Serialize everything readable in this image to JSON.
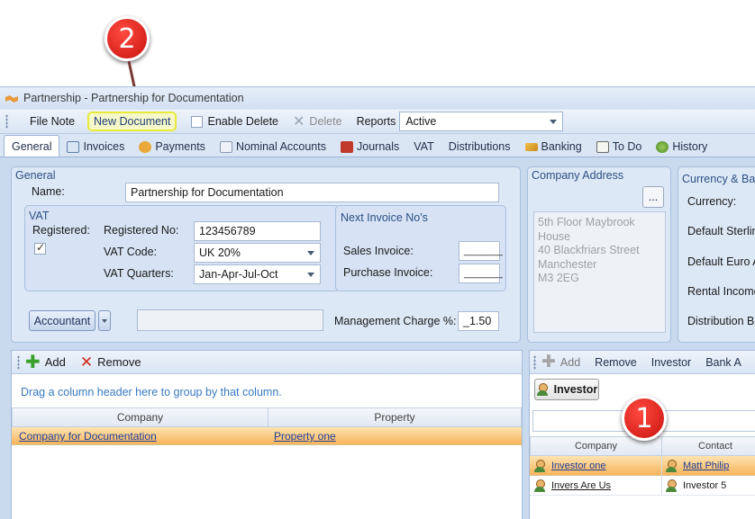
{
  "window": {
    "title": "Partnership - Partnership for Documentation"
  },
  "toolbar": {
    "file_note": "File Note",
    "new_document": "New Document",
    "enable_delete": "Enable Delete",
    "delete": "Delete",
    "reports_label": "Reports",
    "reports_value": "Active"
  },
  "tabs": [
    {
      "label": "General"
    },
    {
      "label": "Invoices"
    },
    {
      "label": "Payments"
    },
    {
      "label": "Nominal Accounts"
    },
    {
      "label": "Journals"
    },
    {
      "label": "VAT"
    },
    {
      "label": "Distributions"
    },
    {
      "label": "Banking"
    },
    {
      "label": "To Do"
    },
    {
      "label": "History"
    }
  ],
  "general": {
    "section_title": "General",
    "name_label": "Name:",
    "name_value": "Partnership for Documentation",
    "vat": {
      "title": "VAT",
      "registered_label": "Registered:",
      "registered_no_label": "Registered No:",
      "registered_no_value": "123456789",
      "vat_code_label": "VAT Code:",
      "vat_code_value": "UK 20%",
      "vat_quarters_label": "VAT Quarters:",
      "vat_quarters_value": "Jan-Apr-Jul-Oct"
    },
    "next_invoice": {
      "title": "Next Invoice No's",
      "sales_label": "Sales Invoice:",
      "sales_value": "_______",
      "purchase_label": "Purchase Invoice:",
      "purchase_value": "_______"
    },
    "accountant_button": "Accountant",
    "management_charge_label": "Management Charge %:",
    "management_charge_value": "_1.50"
  },
  "company_address": {
    "title": "Company Address",
    "browse_button": "...",
    "lines": [
      "5th Floor Maybrook",
      "House",
      "40 Blackfriars Street",
      "Manchester",
      "M3 2EG"
    ]
  },
  "currency_bank": {
    "title": "Currency & Ban",
    "labels": [
      "Currency:",
      "Default Sterlin",
      "Default Euro A",
      "Rental Income",
      "Distribution B"
    ]
  },
  "property_grid": {
    "add": "Add",
    "remove": "Remove",
    "group_hint": "Drag a column header here to group by that column.",
    "columns": [
      "Company",
      "Property"
    ],
    "rows": [
      {
        "company": "Company for Documentation",
        "property": "Property one"
      }
    ]
  },
  "investor_grid": {
    "add": "Add",
    "remove": "Remove",
    "investor": "Investor",
    "bank": "Bank A",
    "group_chip": "Investor",
    "columns": [
      "Company",
      "Contact"
    ],
    "rows": [
      {
        "company": "Investor one",
        "contact": "Matt Philip"
      },
      {
        "company": "Invers Are Us",
        "contact": "Investor 5"
      }
    ]
  },
  "callouts": {
    "one": "1",
    "two": "2"
  },
  "colors": {
    "accent": "#2c4f84",
    "selected_row": "#f8b45c",
    "callout": "#d9201a",
    "highlight": "#e8e93a"
  }
}
